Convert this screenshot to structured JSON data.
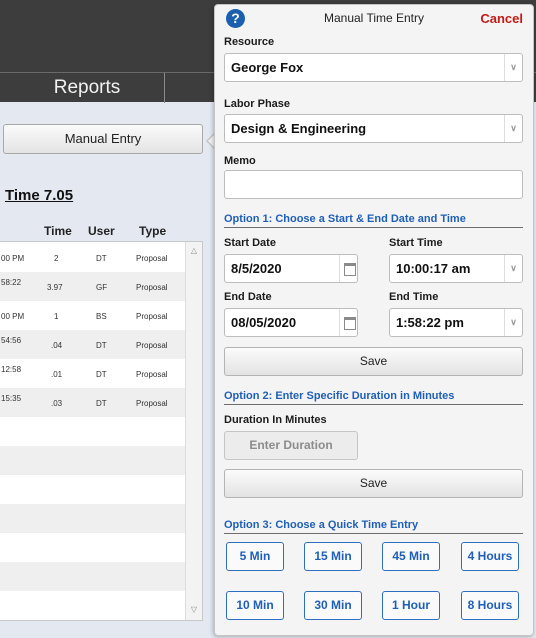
{
  "background": {
    "nav_tab": "Reports",
    "manual_entry_button": "Manual Entry",
    "total_time": "Time 7.05",
    "columns": [
      "Time",
      "User",
      "Type"
    ],
    "rows": [
      {
        "clip": "00 PM",
        "time": "2",
        "user": "DT",
        "type": "Proposal"
      },
      {
        "clip": "58:22",
        "time": "3.97",
        "user": "GF",
        "type": "Proposal"
      },
      {
        "clip": "00 PM",
        "time": "1",
        "user": "BS",
        "type": "Proposal"
      },
      {
        "clip": "54:56",
        "time": ".04",
        "user": "DT",
        "type": "Proposal"
      },
      {
        "clip": "12:58",
        "time": ".01",
        "user": "DT",
        "type": "Proposal"
      },
      {
        "clip": "15:35",
        "time": ".03",
        "user": "DT",
        "type": "Proposal"
      }
    ]
  },
  "panel": {
    "title": "Manual Time Entry",
    "help_icon": "?",
    "cancel": "Cancel",
    "resource_label": "Resource",
    "resource_value": "George Fox",
    "labor_label": "Labor Phase",
    "labor_value": "Design & Engineering",
    "memo_label": "Memo",
    "memo_value": "",
    "option1_title": "Option 1: Choose a Start & End Date and Time",
    "start_date_label": "Start Date",
    "start_date_value": "8/5/2020",
    "start_time_label": "Start Time",
    "start_time_value": "10:00:17 am",
    "end_date_label": "End Date",
    "end_date_value": "08/05/2020",
    "end_time_label": "End Time",
    "end_time_value": "1:58:22 pm",
    "save1": "Save",
    "option2_title": "Option 2: Enter Specific Duration in Minutes",
    "duration_label": "Duration In Minutes",
    "duration_button": "Enter Duration",
    "save2": "Save",
    "option3_title": "Option 3: Choose a Quick Time Entry",
    "quick": [
      "5 Min",
      "15 Min",
      "45 Min",
      "4 Hours",
      "10 Min",
      "30 Min",
      "1 Hour",
      "8 Hours"
    ]
  },
  "icons": {
    "dropdown": "chevron-down-icon",
    "calendar": "calendar-icon",
    "help": "help-icon"
  },
  "colors": {
    "accent": "#1f5fb8",
    "cancel": "#c51a1a",
    "topbar": "#3d3d3d"
  }
}
